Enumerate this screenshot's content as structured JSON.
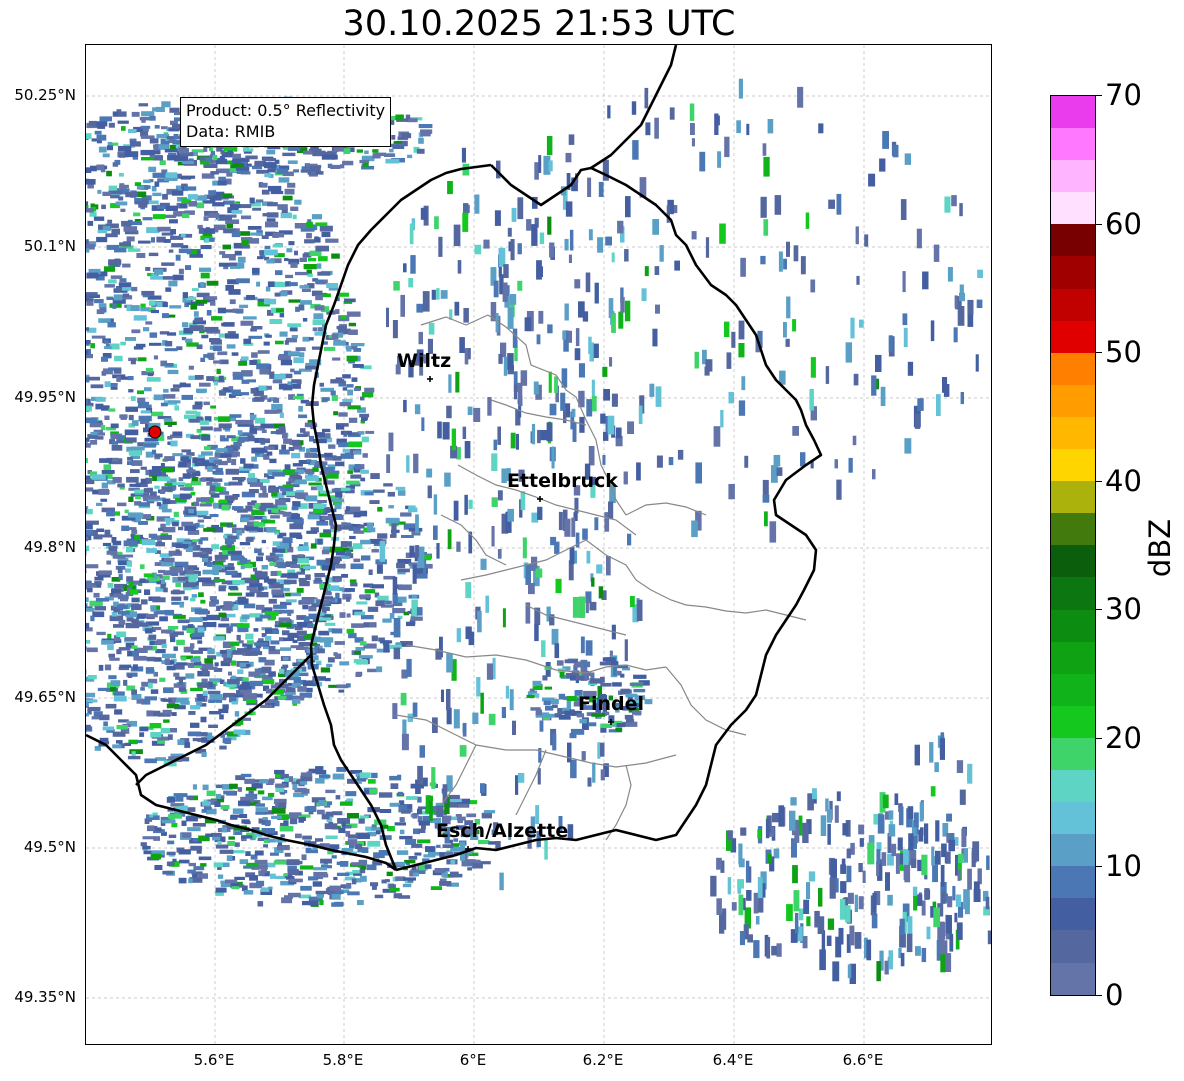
{
  "title": "30.10.2025 21:53 UTC",
  "info": {
    "product": "Product: 0.5° Reflectivity",
    "data": "Data: RMIB"
  },
  "lat_labels": [
    "50.25°N",
    "50.1°N",
    "49.95°N",
    "49.8°N",
    "49.65°N",
    "49.5°N",
    "49.35°N"
  ],
  "lon_labels": [
    "5.6°E",
    "5.8°E",
    "6°E",
    "6.2°E",
    "6.4°E",
    "6.6°E"
  ],
  "cities": [
    {
      "name": "Wiltz"
    },
    {
      "name": "Ettelbruck"
    },
    {
      "name": "Findel"
    },
    {
      "name": "Esch/Alzette"
    }
  ],
  "colorbar": {
    "label": "dBZ",
    "ticks": [
      "0",
      "10",
      "20",
      "30",
      "40",
      "50",
      "60",
      "70"
    ],
    "colors": [
      "#6473a8",
      "#54679f",
      "#435ea1",
      "#4b78b4",
      "#5a9fc6",
      "#64c2d8",
      "#5ed4c4",
      "#3fd46a",
      "#14c81e",
      "#10b41a",
      "#0fa314",
      "#0d8c12",
      "#0c7610",
      "#0a5e0c",
      "#427a0e",
      "#aab20b",
      "#ffd500",
      "#ffb700",
      "#ff9c00",
      "#ff7f00",
      "#e10000",
      "#c10000",
      "#a00000",
      "#780000",
      "#ffe0ff",
      "#ffb4ff",
      "#ff78ff",
      "#ea3ced"
    ]
  },
  "radar_site": {
    "color": "#e00000"
  }
}
